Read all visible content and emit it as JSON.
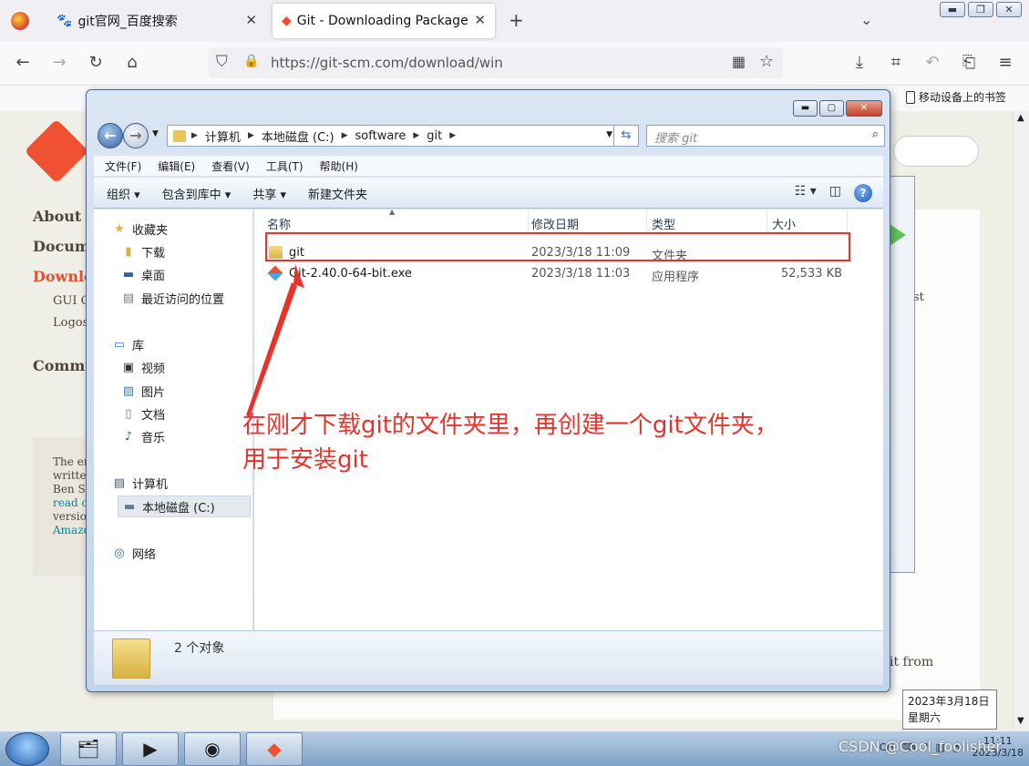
{
  "browser": {
    "tabs": [
      {
        "label": "git官网_百度搜索",
        "active": false
      },
      {
        "label": "Git - Downloading Package",
        "active": true
      }
    ],
    "url": "https://git-scm.com/download/win",
    "bookmark_label": "移动设备上的书签"
  },
  "page": {
    "nav": [
      "About",
      "Documentation",
      "Downloads"
    ],
    "subnav": [
      "GUI Clients",
      "Logos"
    ],
    "community": "Community",
    "book_lines": [
      "The entire Pro Git book",
      "written by Scott Chacon and",
      "Ben Straub is available to",
      "read online for free. Dead tree",
      "versions are available on",
      "Amazon.com."
    ],
    "right_snippet_1": "st",
    "right_snippet_2": "it from"
  },
  "explorer": {
    "breadcrumb": [
      "计算机",
      "本地磁盘 (C:)",
      "software",
      "git"
    ],
    "search_placeholder": "搜索 git",
    "menu": [
      "文件(F)",
      "编辑(E)",
      "查看(V)",
      "工具(T)",
      "帮助(H)"
    ],
    "toolbar": [
      "组织 ▾",
      "包含到库中 ▾",
      "共享 ▾",
      "新建文件夹"
    ],
    "nav": {
      "favorites": "收藏夹",
      "fav_items": [
        "下载",
        "桌面",
        "最近访问的位置"
      ],
      "libraries": "库",
      "lib_items": [
        "视频",
        "图片",
        "文档",
        "音乐"
      ],
      "computer": "计算机",
      "drive": "本地磁盘 (C:)",
      "network": "网络"
    },
    "columns": [
      "名称",
      "修改日期",
      "类型",
      "大小"
    ],
    "files": [
      {
        "name": "git",
        "date": "2023/3/18 11:09",
        "type": "文件夹",
        "size": ""
      },
      {
        "name": "Git-2.40.0-64-bit.exe",
        "date": "2023/3/18 11:03",
        "type": "应用程序",
        "size": "52,533 KB"
      }
    ],
    "status": "2 个对象"
  },
  "annotation": {
    "line1": "在刚才下载git的文件夹里，再创建一个git文件夹，",
    "line2": "用于安装git",
    "color": "#e8322c"
  },
  "taskbar": {
    "tooltip_date": "2023年3月18日",
    "tooltip_day": "星期六",
    "clock_time": "11:11",
    "clock_date": "2023/3/18",
    "lang": "CH",
    "watermark": "CSDN @Cool_foolisher"
  }
}
